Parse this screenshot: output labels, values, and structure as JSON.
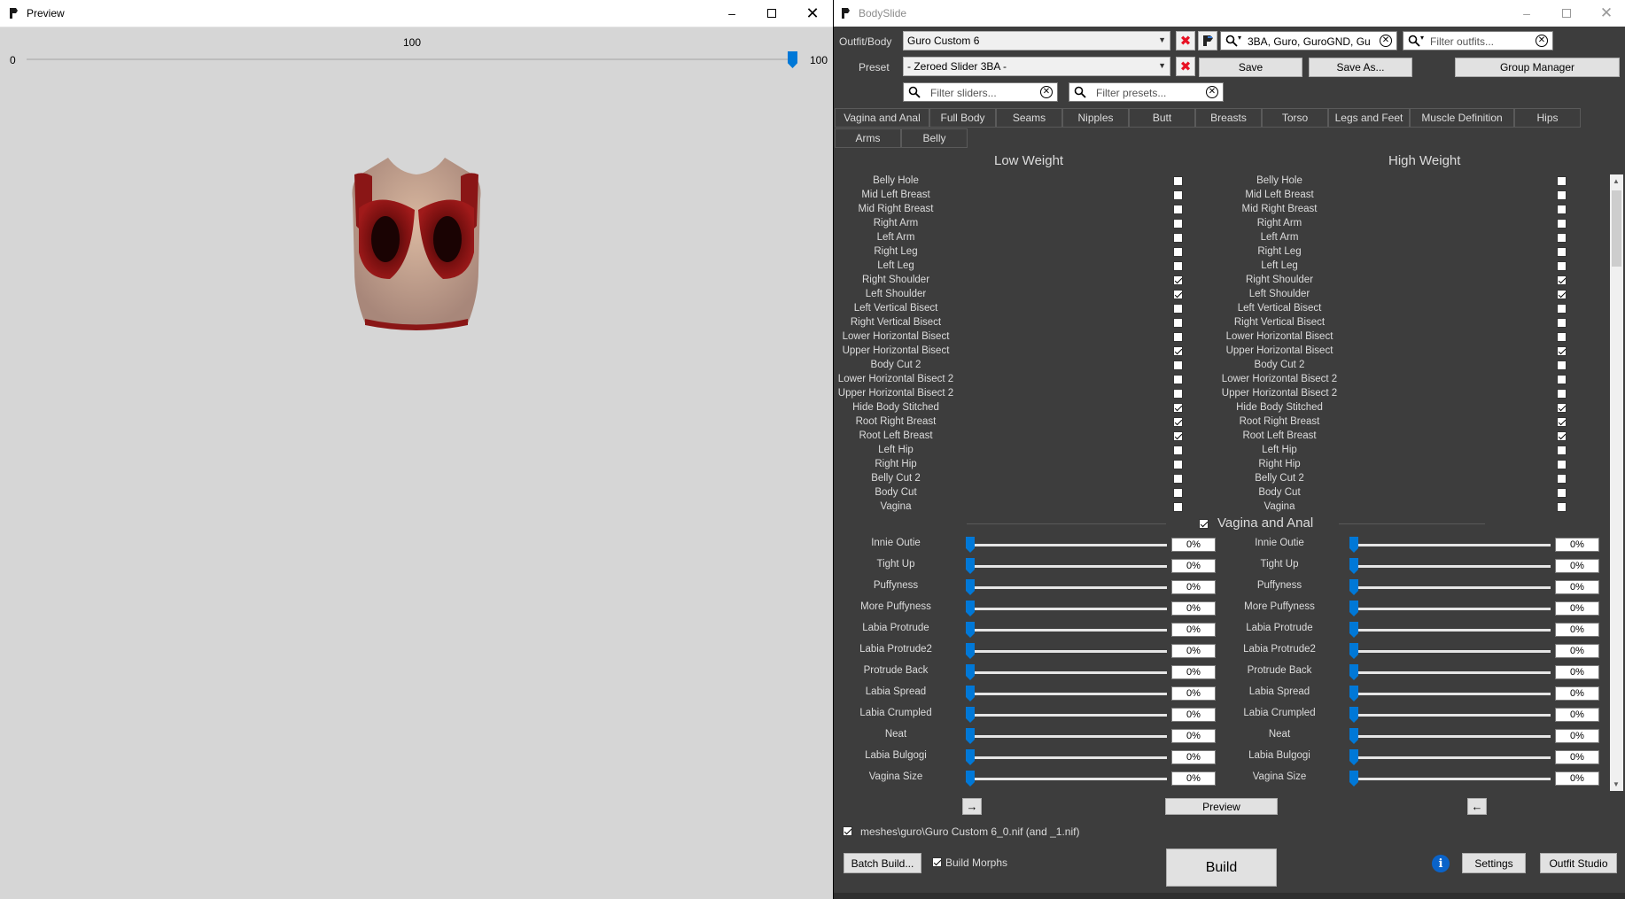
{
  "preview": {
    "title": "Preview",
    "slider_value": "100",
    "slider_min": "0",
    "slider_max": "100",
    "slider_fraction": 1.0
  },
  "bodyslide": {
    "title": "BodySlide",
    "outfit_label": "Outfit/Body",
    "outfit_value": "Guro Custom 6",
    "preset_label": "Preset",
    "preset_value": "- Zeroed Slider 3BA -",
    "group_filter_value": "3BA, Guro, GuroGND, Gu",
    "outfit_filter_placeholder": "Filter outfits...",
    "slider_filter_placeholder": "Filter sliders...",
    "preset_filter_placeholder": "Filter presets...",
    "save_label": "Save",
    "save_as_label": "Save As...",
    "group_manager_label": "Group Manager",
    "tabs": [
      "Vagina and Anal",
      "Full Body",
      "Seams",
      "Nipples",
      "Butt",
      "Breasts",
      "Torso",
      "Legs and Feet",
      "Muscle Definition",
      "Hips",
      "Arms",
      "Belly"
    ],
    "low_weight_header": "Low Weight",
    "high_weight_header": "High Weight",
    "zap_sliders": [
      {
        "name": "Belly Hole",
        "low": false,
        "high": false
      },
      {
        "name": "Mid Left Breast",
        "low": false,
        "high": false
      },
      {
        "name": "Mid Right Breast",
        "low": false,
        "high": false
      },
      {
        "name": "Right Arm",
        "low": false,
        "high": false
      },
      {
        "name": "Left Arm",
        "low": false,
        "high": false
      },
      {
        "name": "Right Leg",
        "low": false,
        "high": false
      },
      {
        "name": "Left Leg",
        "low": false,
        "high": false
      },
      {
        "name": "Right Shoulder",
        "low": true,
        "high": true
      },
      {
        "name": "Left Shoulder",
        "low": true,
        "high": true
      },
      {
        "name": "Left Vertical Bisect",
        "low": false,
        "high": false
      },
      {
        "name": "Right Vertical Bisect",
        "low": false,
        "high": false
      },
      {
        "name": "Lower Horizontal Bisect",
        "low": false,
        "high": false
      },
      {
        "name": "Upper Horizontal Bisect",
        "low": true,
        "high": true
      },
      {
        "name": "Body Cut 2",
        "low": false,
        "high": false
      },
      {
        "name": "Lower Horizontal Bisect 2",
        "low": false,
        "high": false
      },
      {
        "name": "Upper Horizontal Bisect 2",
        "low": false,
        "high": false
      },
      {
        "name": "Hide Body Stitched",
        "low": true,
        "high": true
      },
      {
        "name": "Root Right Breast",
        "low": true,
        "high": true
      },
      {
        "name": "Root Left Breast",
        "low": true,
        "high": true
      },
      {
        "name": "Left Hip",
        "low": false,
        "high": false
      },
      {
        "name": "Right Hip",
        "low": false,
        "high": false
      },
      {
        "name": "Belly Cut 2",
        "low": false,
        "high": false
      },
      {
        "name": "Body Cut",
        "low": false,
        "high": false
      },
      {
        "name": "Vagina",
        "low": false,
        "high": false
      }
    ],
    "section_title": "Vagina and Anal",
    "section_checked": true,
    "value_sliders": [
      {
        "name": "Innie Outie",
        "low": "0%",
        "high": "0%"
      },
      {
        "name": "Tight Up",
        "low": "0%",
        "high": "0%"
      },
      {
        "name": "Puffyness",
        "low": "0%",
        "high": "0%"
      },
      {
        "name": "More Puffyness",
        "low": "0%",
        "high": "0%"
      },
      {
        "name": "Labia Protrude",
        "low": "0%",
        "high": "0%"
      },
      {
        "name": "Labia Protrude2",
        "low": "0%",
        "high": "0%"
      },
      {
        "name": "Protrude Back",
        "low": "0%",
        "high": "0%"
      },
      {
        "name": "Labia Spread",
        "low": "0%",
        "high": "0%"
      },
      {
        "name": "Labia Crumpled",
        "low": "0%",
        "high": "0%"
      },
      {
        "name": "Neat",
        "low": "0%",
        "high": "0%"
      },
      {
        "name": "Labia Bulgogi",
        "low": "0%",
        "high": "0%"
      },
      {
        "name": "Vagina Size",
        "low": "0%",
        "high": "0%"
      }
    ],
    "copy_right_arrow": "→",
    "copy_left_arrow": "←",
    "preview_button": "Preview",
    "output_path": "meshes\\guro\\Guro Custom 6_0.nif (and _1.nif)",
    "output_checked": true,
    "batch_build_label": "Batch Build...",
    "build_morphs_label": "Build Morphs",
    "build_morphs_checked": true,
    "build_label": "Build",
    "settings_label": "Settings",
    "outfit_studio_label": "Outfit Studio"
  }
}
